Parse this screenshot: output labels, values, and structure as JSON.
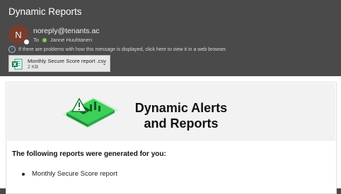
{
  "header": {
    "subject": "Dynamic Reports",
    "sender_initial": "N",
    "sender_email": "noreply@tenants.ac",
    "to_label": "To",
    "recipient": "Janne Huuhtanen",
    "info_message": "If there are problems with how this message is displayed, click here to view it in a web browser."
  },
  "attachment": {
    "name": "Monthly Secure Score report .csv",
    "size": "2 KB",
    "icon": "excel-icon"
  },
  "body": {
    "banner_title_line1": "Dynamic Alerts",
    "banner_title_line2": "and Reports",
    "heading": "The following reports were generated for you:",
    "reports": [
      "Monthly Secure Score report"
    ]
  },
  "colors": {
    "window_bg": "#4a4a4a",
    "avatar_bg": "#7a3c2c",
    "presence_green": "#92c353",
    "accent_green": "#3ecf5a",
    "banner_bg": "#f2f2f2"
  }
}
